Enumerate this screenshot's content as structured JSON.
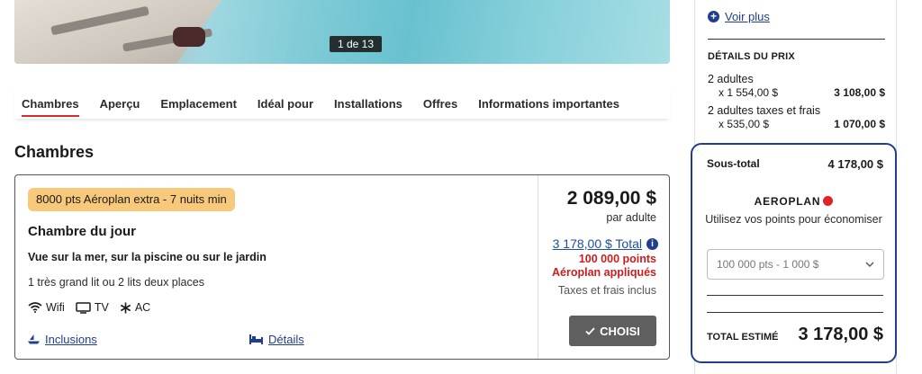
{
  "hero": {
    "counter": "1 de 13"
  },
  "tabs": [
    {
      "label": "Chambres",
      "active": true
    },
    {
      "label": "Aperçu"
    },
    {
      "label": "Emplacement"
    },
    {
      "label": "Idéal pour"
    },
    {
      "label": "Installations"
    },
    {
      "label": "Offres"
    },
    {
      "label": "Informations importantes"
    }
  ],
  "section_title": "Chambres",
  "room": {
    "promo": "8000 pts Aéroplan extra - 7 nuits min",
    "name": "Chambre du jour",
    "view": "Vue sur la mer, sur la piscine ou sur le jardin",
    "beds": "1 très grand lit ou 2 lits deux places",
    "amenities": [
      {
        "icon": "wifi-icon",
        "label": "Wifi"
      },
      {
        "icon": "tv-icon",
        "label": "TV"
      },
      {
        "icon": "snowflake-icon",
        "label": "AC"
      }
    ],
    "inclusions_link": "Inclusions",
    "details_link": "Détails",
    "price": "2 089,00 $",
    "per": "par adulte",
    "total": "3 178,00 $ Total",
    "points_line1": "100 000 points",
    "points_line2": "Aéroplan appliqués",
    "taxes": "Taxes et frais inclus",
    "choose_label": "CHOISI"
  },
  "sidebar": {
    "voir_plus": "Voir plus",
    "price_details_title": "DÉTAILS DU PRIX",
    "lines": [
      {
        "label": "2 adultes",
        "qty": "x 1 554,00 $",
        "amount": "3 108,00 $"
      },
      {
        "label": "2 adultes taxes et frais",
        "qty": "x 535,00 $",
        "amount": "1 070,00 $"
      }
    ],
    "subtotal_label": "Sous-total",
    "subtotal_value": "4 178,00 $",
    "aeroplan_brand": "AEROPLAN",
    "aeroplan_text": "Utilisez vos points pour économiser",
    "points_select": "100 000 pts - 1 000 $",
    "total_label": "TOTAL ESTIMÉ",
    "total_value": "3 178,00 $"
  },
  "colors": {
    "accent_blue": "#1f3f8c",
    "active_tab_red": "#d62c2c",
    "points_red": "#c81e1e",
    "promo_bg": "#f8c97a",
    "button_gray": "#5f5f5f"
  }
}
